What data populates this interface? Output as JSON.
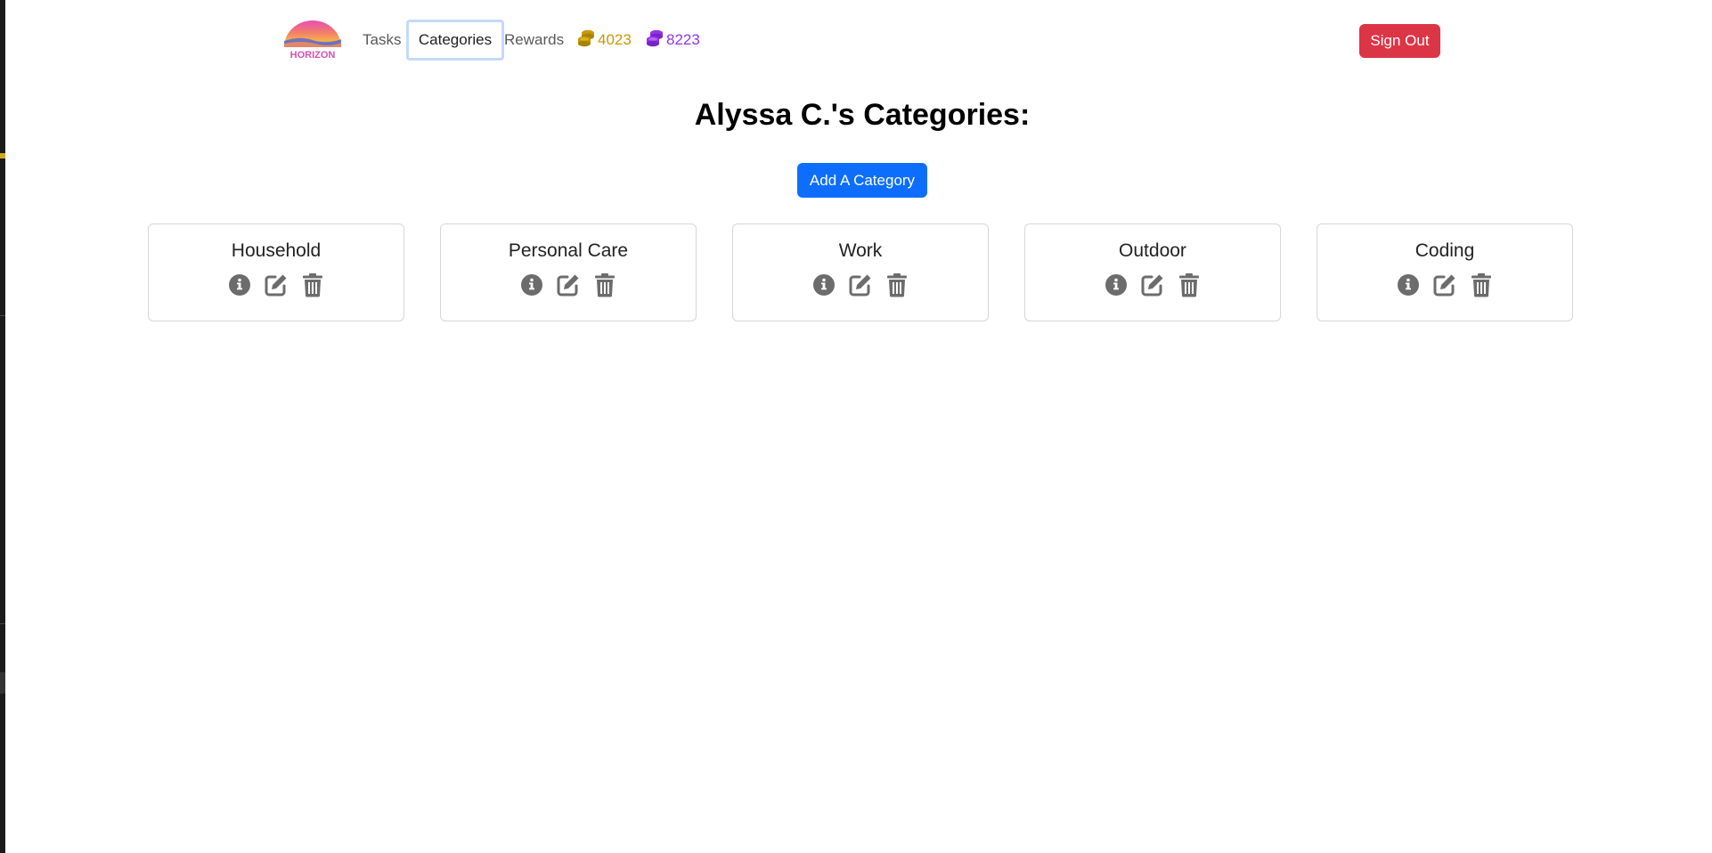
{
  "nav": {
    "logo_text": "HORIZON",
    "links": [
      {
        "label": "Tasks",
        "active": false
      },
      {
        "label": "Categories",
        "active": true
      },
      {
        "label": "Rewards",
        "active": false
      }
    ],
    "coins": {
      "gold": {
        "value": "4023",
        "icon": "coins-icon",
        "color": "#c49a00"
      },
      "purple": {
        "value": "8223",
        "icon": "coins-icon",
        "color": "#9333ea"
      }
    },
    "sign_out_label": "Sign Out"
  },
  "main": {
    "title": "Alyssa C.'s Categories:",
    "add_button_label": "Add A Category",
    "categories": [
      {
        "name": "Household",
        "actions": [
          "info-icon",
          "edit-icon",
          "trash-icon"
        ]
      },
      {
        "name": "Personal Care",
        "actions": [
          "info-icon",
          "edit-icon",
          "trash-icon"
        ]
      },
      {
        "name": "Work",
        "actions": [
          "info-icon",
          "edit-icon",
          "trash-icon"
        ]
      },
      {
        "name": "Outdoor",
        "actions": [
          "info-icon",
          "edit-icon",
          "trash-icon"
        ]
      },
      {
        "name": "Coding",
        "actions": [
          "info-icon",
          "edit-icon",
          "trash-icon"
        ]
      }
    ]
  },
  "colors": {
    "primary": "#0d6efd",
    "danger": "#dc3545",
    "icon_gray": "#6c6c6c"
  }
}
